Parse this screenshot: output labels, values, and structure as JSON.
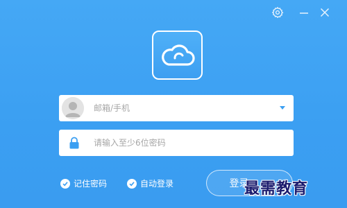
{
  "window_controls": {
    "settings_icon": "gear-icon",
    "minimize_icon": "minimize-icon",
    "close_icon": "close-icon"
  },
  "logo": {
    "icon": "cloud-icon"
  },
  "account": {
    "placeholder": "邮箱/手机",
    "value": ""
  },
  "password": {
    "placeholder": "请输入至少6位密码",
    "value": ""
  },
  "options": {
    "remember_label": "记住密码",
    "remember_checked": true,
    "auto_login_label": "自动登录",
    "auto_login_checked": true
  },
  "login_button": {
    "label": "登录"
  },
  "watermark": {
    "text": "最需教育"
  },
  "colors": {
    "background": "#3b9ff2",
    "accent": "#3b9ff2",
    "field_bg": "#ffffff",
    "text_light": "#ffffff"
  }
}
